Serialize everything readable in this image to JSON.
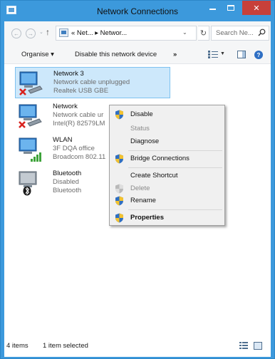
{
  "window": {
    "title": "Network Connections"
  },
  "address_bar": {
    "path_text": "« Net... ▸ Networ...",
    "search_placeholder": "Search Ne..."
  },
  "toolbar": {
    "organise_label": "Organise ▾",
    "disable_label": "Disable this network device",
    "more_label": "»"
  },
  "connections": [
    {
      "name": "Network 3",
      "status": "Network cable unplugged",
      "device": "Realtek USB GBE",
      "type": "ethernet-unplugged",
      "selected": true
    },
    {
      "name": "Network",
      "status": "Network cable ur",
      "device": "Intel(R) 82579LM",
      "type": "ethernet-unplugged",
      "selected": false
    },
    {
      "name": "WLAN",
      "status": "3F DQA office",
      "device": "Broadcom 802.11",
      "type": "wifi",
      "selected": false
    },
    {
      "name": "Bluetooth",
      "status": "Disabled",
      "device": "Bluetooth",
      "type": "bluetooth",
      "selected": false
    }
  ],
  "context_menu": {
    "items": [
      {
        "label": "Disable",
        "shield": true,
        "disabled": false,
        "bold": false
      },
      {
        "label": "Status",
        "shield": false,
        "disabled": true,
        "bold": false
      },
      {
        "label": "Diagnose",
        "shield": false,
        "disabled": false,
        "bold": false
      },
      {
        "label": "Bridge Connections",
        "shield": true,
        "disabled": false,
        "bold": false
      },
      {
        "label": "Create Shortcut",
        "shield": false,
        "disabled": false,
        "bold": false
      },
      {
        "label": "Delete",
        "shield": true,
        "disabled": true,
        "bold": false
      },
      {
        "label": "Rename",
        "shield": true,
        "disabled": false,
        "bold": false
      },
      {
        "label": "Properties",
        "shield": true,
        "disabled": false,
        "bold": true
      }
    ]
  },
  "status_bar": {
    "item_count": "4 items",
    "selection": "1 item selected"
  },
  "colors": {
    "title_bar": "#3c99dc",
    "close_button": "#c7403a",
    "selection_fill": "#cde8fb",
    "selection_border": "#7ec2f0"
  }
}
